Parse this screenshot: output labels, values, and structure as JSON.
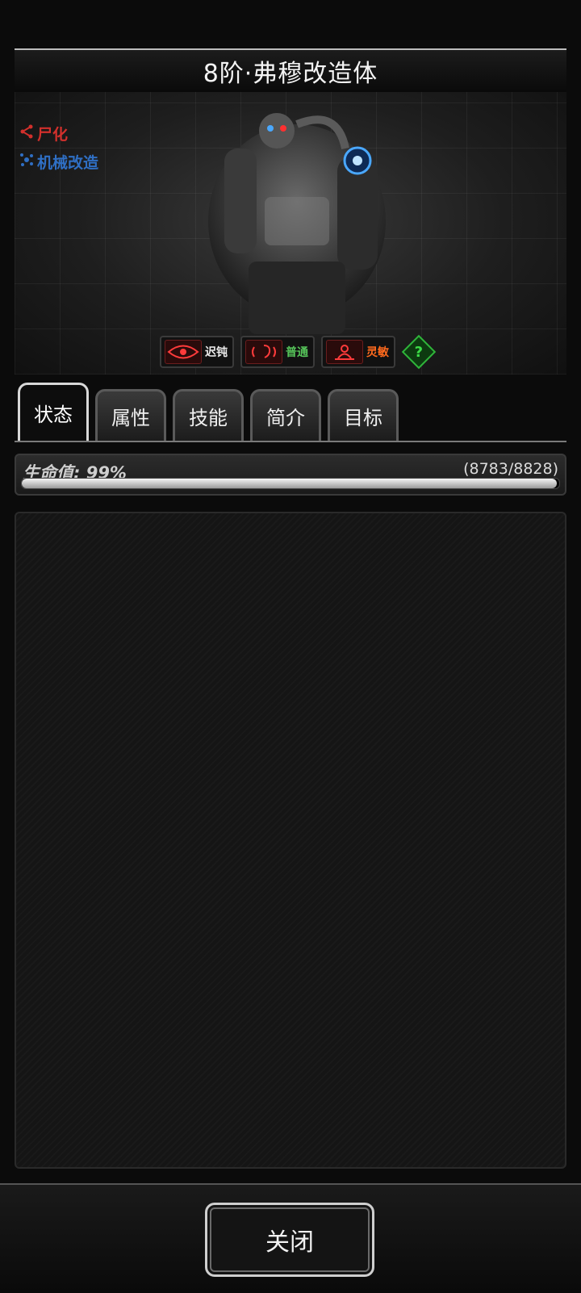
{
  "header": {
    "title": "8阶·弗穆改造体"
  },
  "portrait": {
    "tags": [
      {
        "label": "尸化",
        "icon": "share-icon",
        "color": "#d2302c"
      },
      {
        "label": "机械改造",
        "icon": "gear-nodes-icon",
        "color": "#2f6fc4"
      }
    ],
    "traits": [
      {
        "label": "迟钝",
        "icon": "eye-icon",
        "color": "#ececec"
      },
      {
        "label": "普通",
        "icon": "ear-icon",
        "color": "#56c45a"
      },
      {
        "label": "灵敏",
        "icon": "spirit-icon",
        "color": "#ff6a1e"
      }
    ],
    "help": "?"
  },
  "tabs": [
    {
      "label": "状态",
      "active": true
    },
    {
      "label": "属性",
      "active": false
    },
    {
      "label": "技能",
      "active": false
    },
    {
      "label": "简介",
      "active": false
    },
    {
      "label": "目标",
      "active": false
    }
  ],
  "hp": {
    "label": "生命值:  99%",
    "value_text": "(8783/8828)",
    "current": 8783,
    "max": 8828
  },
  "footer": {
    "close_label": "关闭"
  }
}
